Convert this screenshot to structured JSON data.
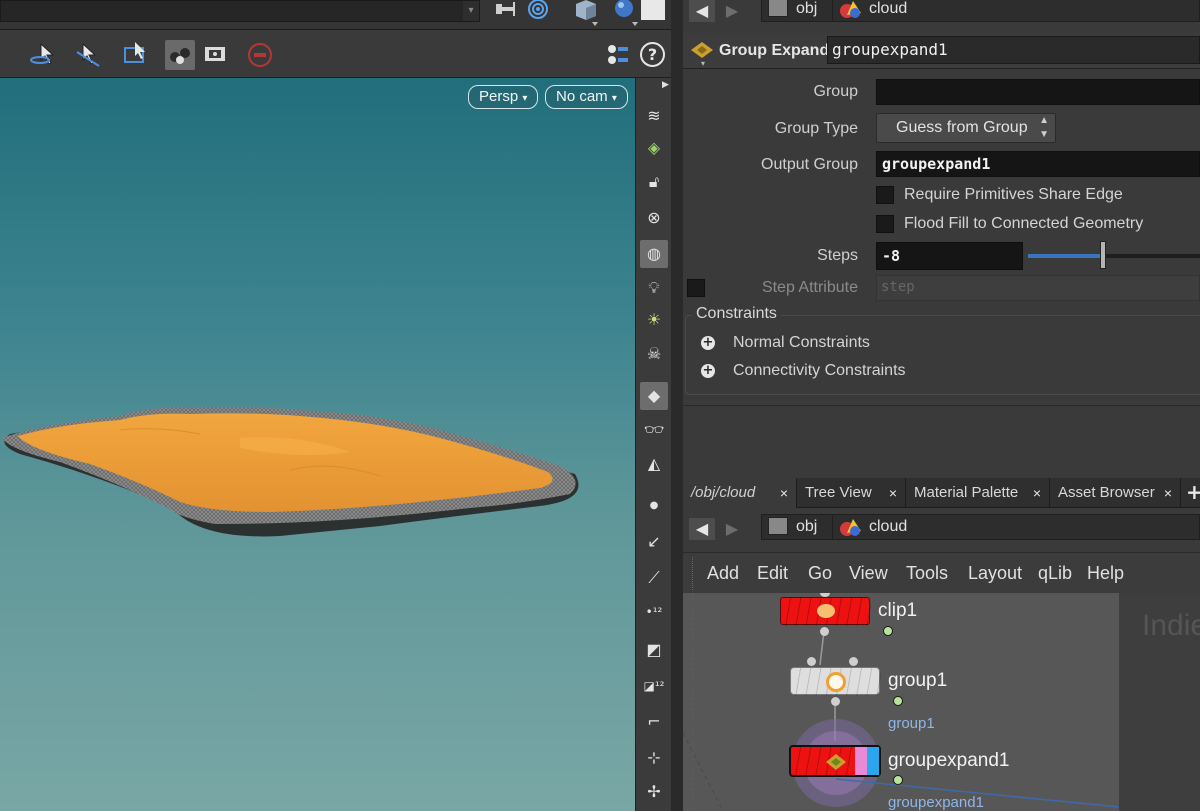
{
  "viewport": {
    "persp_label": "Persp",
    "cam_label": "No cam",
    "colors": {
      "sky_top": "#216e7c",
      "sky_bottom": "#79a7a5",
      "cloud": "#ee9f38"
    }
  },
  "param_path": {
    "obj": "obj",
    "node": "cloud"
  },
  "params": {
    "node_type": "Group Expand",
    "node_name": "groupexpand1",
    "group_label": "Group",
    "group_value": "",
    "group_type_label": "Group Type",
    "group_type_value": "Guess from Group",
    "output_group_label": "Output Group",
    "output_group_value": "groupexpand1",
    "require_prims_label": "Require Primitives Share Edge",
    "flood_fill_label": "Flood Fill to Connected Geometry",
    "steps_label": "Steps",
    "steps_value": "-8",
    "step_attr_label": "Step Attribute",
    "step_attr_placeholder": "step",
    "constraints_label": "Constraints",
    "normal_constraints_label": "Normal Constraints",
    "connectivity_constraints_label": "Connectivity Constraints"
  },
  "tabs": [
    {
      "label": "/obj/cloud",
      "close": "×"
    },
    {
      "label": "Tree View",
      "close": "×"
    },
    {
      "label": "Material Palette",
      "close": "×"
    },
    {
      "label": "Asset Browser",
      "close": "×"
    }
  ],
  "tab_add": "+",
  "network_path": {
    "obj": "obj",
    "node": "cloud"
  },
  "menu": [
    "Add",
    "Edit",
    "Go",
    "View",
    "Tools",
    "Layout",
    "qLib",
    "Help"
  ],
  "nodes": {
    "clip": {
      "name": "clip1",
      "color": "#ee1111"
    },
    "group": {
      "name": "group1",
      "group_link": "group1"
    },
    "groupexpand": {
      "name": "groupexpand1",
      "group_link": "groupexpand1"
    }
  },
  "watermark": "Indie"
}
